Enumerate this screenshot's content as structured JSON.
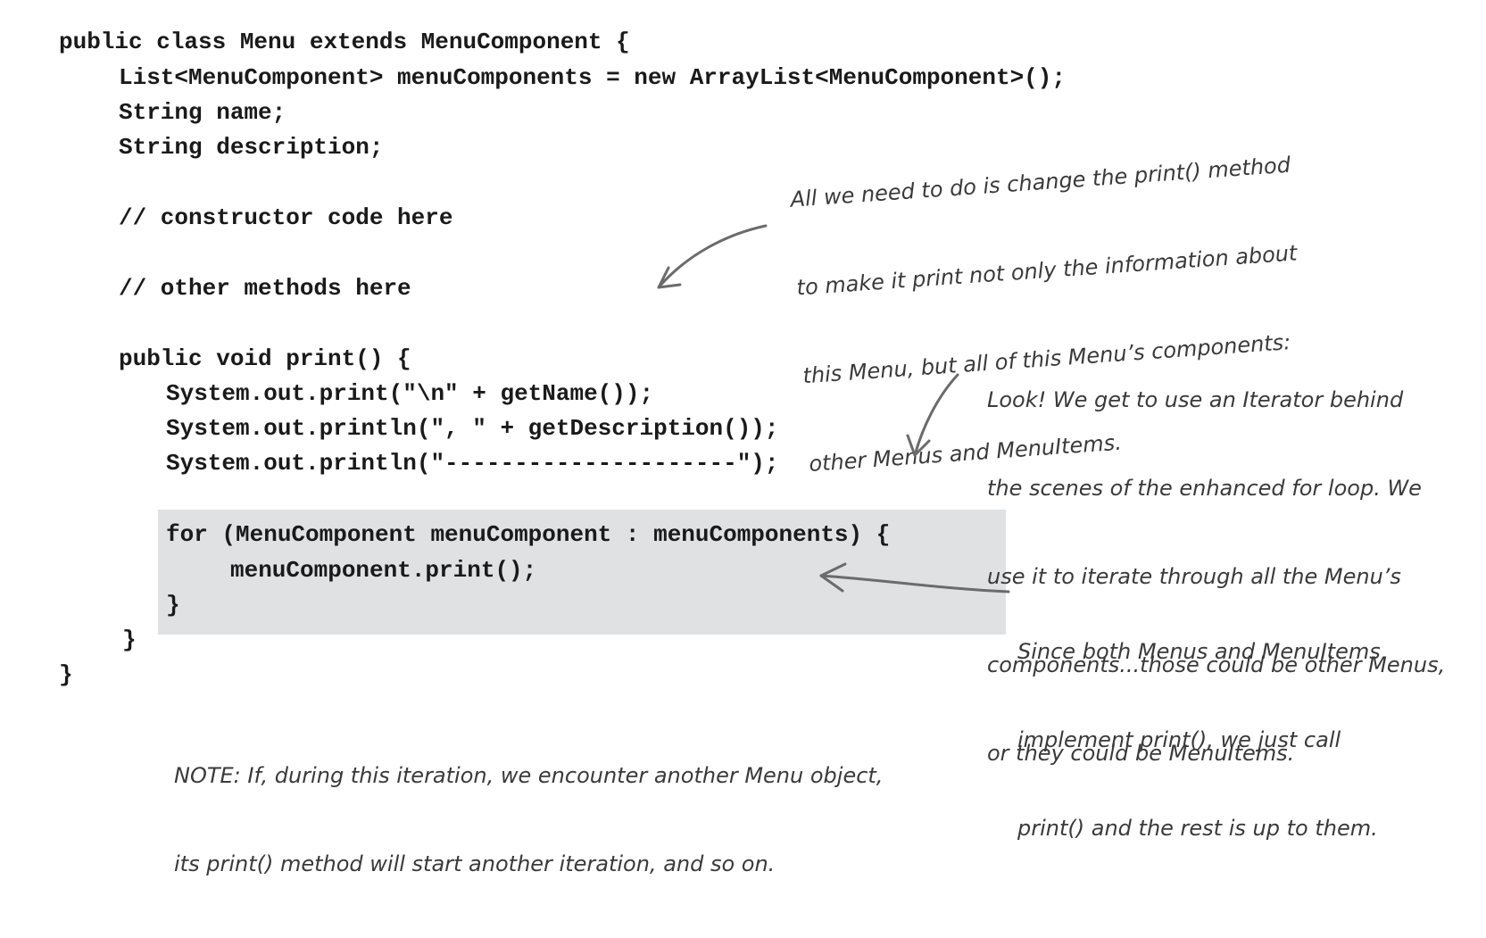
{
  "code": {
    "lines": [
      "public class Menu extends MenuComponent {",
      "List<MenuComponent> menuComponents = new ArrayList<MenuComponent>();",
      "String name;",
      "String description;",
      "// constructor code here",
      "// other methods here",
      "public void print() {",
      "System.out.print(\"\\n\" + getName());",
      "System.out.println(\", \" + getDescription());",
      "System.out.println(\"---------------------\");",
      "for (MenuComponent menuComponent : menuComponents) {",
      "menuComponent.print();",
      "}",
      "}",
      "}"
    ]
  },
  "annotations": {
    "print_change": [
      "All we need to do is change the print() method",
      "to make it print not only the information about",
      "this Menu, but all of this Menu’s components:",
      "other Menus and MenuItems."
    ],
    "iterator": [
      "Look! We get to use an Iterator behind",
      "the scenes of the enhanced for loop. We",
      "use it to iterate through all the Menu’s",
      "components...those could be other Menus,",
      "or they could be MenuItems."
    ],
    "both_implement": [
      "Since both Menus and MenuItems",
      "implement print(), we just call",
      "print() and the rest is up to them."
    ],
    "note": [
      "NOTE: If, during this iteration, we encounter another Menu object,",
      "its print() method will start another iteration, and so on."
    ]
  },
  "colors": {
    "highlight": "#e0e1e3",
    "code_text": "#1a1a1a",
    "annotation_text": "#3a3a3a",
    "arrow": "#6b6b6b"
  }
}
